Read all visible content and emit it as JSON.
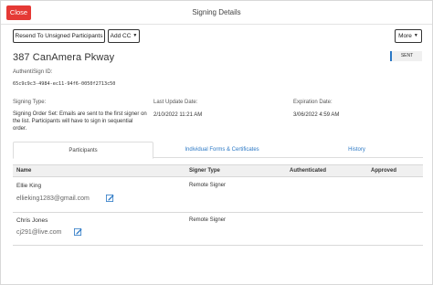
{
  "header": {
    "close_label": "Close",
    "title": "Signing Details"
  },
  "toolbar": {
    "resend_label": "Resend To Unsigned Participants",
    "addcc_label": "Add CC",
    "more_label": "More"
  },
  "document": {
    "address": "387 CanAmera Pkway",
    "status": "SENT",
    "authentisign_id_label": "AuthentiSign ID:",
    "authentisign_id": "65c9c9c3-4984-ec11-94f6-0050f2713c50"
  },
  "meta": {
    "signing_type_label": "Signing Type:",
    "signing_type_value": "Signing Order Set: Emails are sent to the first signer on the list. Participants will have to sign in sequential order.",
    "last_update_label": "Last Update Date:",
    "last_update_value": "2/10/2022 11:21 AM",
    "expiration_label": "Expiration Date:",
    "expiration_value": "3/06/2022 4:59 AM"
  },
  "tabs": [
    {
      "label": "Participants",
      "active": true
    },
    {
      "label": "Individual Forms & Certificates",
      "active": false
    },
    {
      "label": "History",
      "active": false
    }
  ],
  "table": {
    "columns": [
      "Name",
      "Signer Type",
      "Authenticated",
      "Approved"
    ],
    "rows": [
      {
        "name": "Ellie King",
        "email": "ellieking1283@gmail.com",
        "signer_type": "Remote Signer",
        "authenticated": "",
        "approved": ""
      },
      {
        "name": "Chris Jones",
        "email": "cj291@live.com",
        "signer_type": "Remote Signer",
        "authenticated": "",
        "approved": ""
      }
    ]
  },
  "colors": {
    "close": "#e53935",
    "link": "#2b78c5",
    "status_accent": "#2b78c5"
  },
  "icons": {
    "edit_email": "edit-email-icon",
    "caret": "caret-down-icon"
  }
}
